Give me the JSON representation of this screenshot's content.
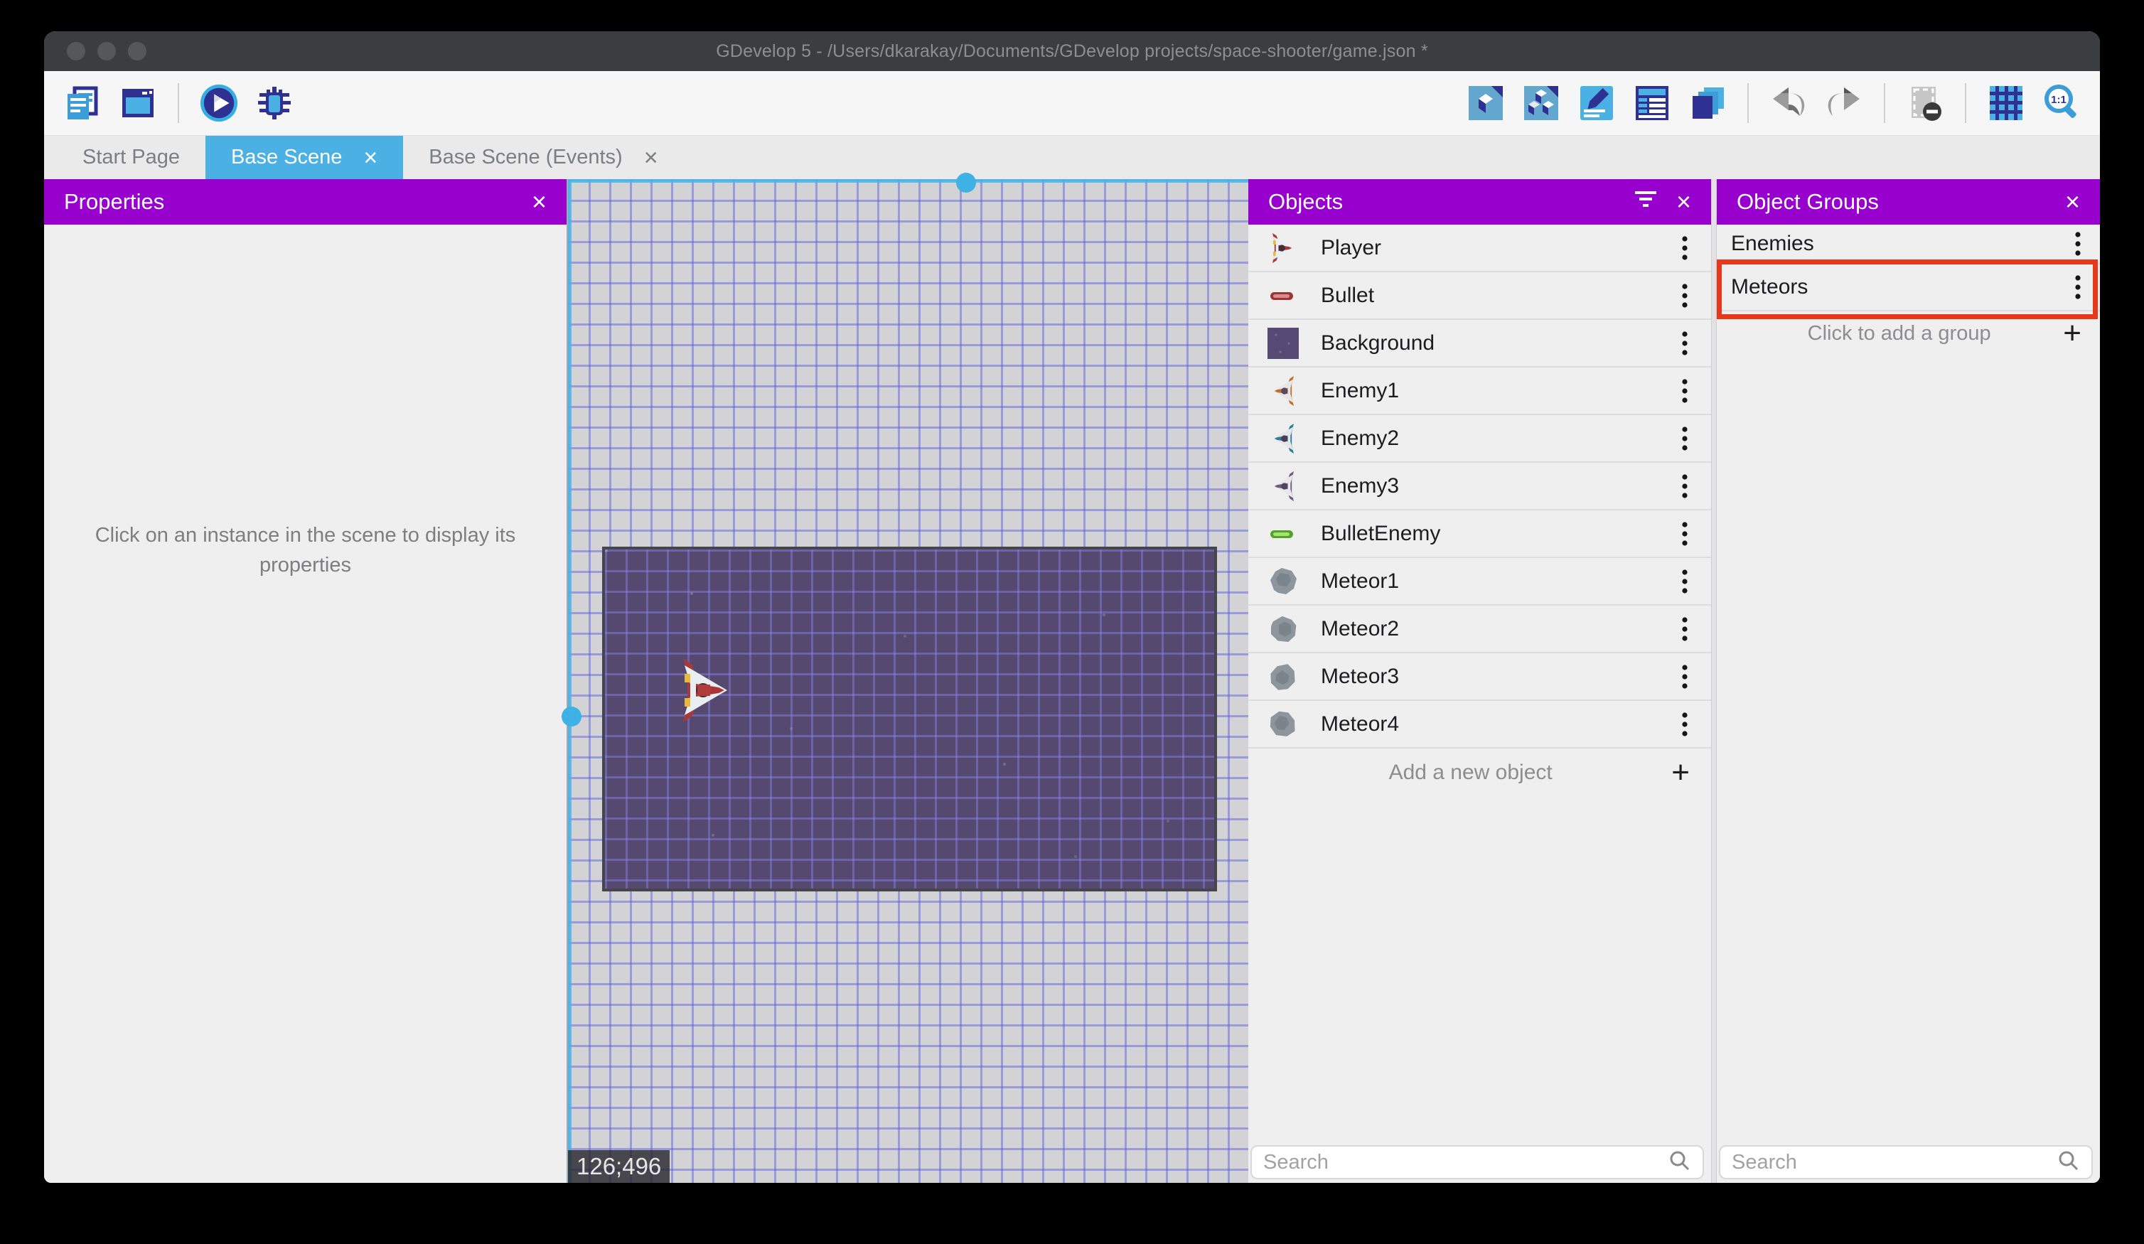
{
  "window": {
    "title": "GDevelop 5 - /Users/dkarakay/Documents/GDevelop projects/space-shooter/game.json *"
  },
  "glyphs": {
    "close": "×",
    "plus": "+"
  },
  "colors": {
    "panel_header_purple": "#9800cd",
    "active_tab_blue": "#4bb0e3",
    "annotation_red": "#e8381c",
    "selection_cyan": "#3eb2e5",
    "titlebar": "#3a3e41"
  },
  "toolbar": {
    "left_icons": [
      "project-manager",
      "start-page-window",
      "preview-play",
      "debug"
    ],
    "right_icons": [
      "edit-object",
      "edit-objects-group",
      "edit-scene-properties",
      "open-instances-list",
      "open-layers",
      "undo",
      "redo",
      "toggle-instances-masks",
      "toggle-grid",
      "zoom-1-1"
    ]
  },
  "tabs": [
    {
      "label": "Start Page",
      "active": false,
      "closable": false
    },
    {
      "label": "Base Scene",
      "active": true,
      "closable": true
    },
    {
      "label": "Base Scene (Events)",
      "active": false,
      "closable": true
    }
  ],
  "properties_panel": {
    "title": "Properties",
    "empty_message": "Click on an instance in the scene to display its properties"
  },
  "scene": {
    "coordinates": "126;496",
    "selected_instance": "Background"
  },
  "objects_panel": {
    "title": "Objects",
    "items": [
      {
        "name": "Player",
        "icon": "player-ship"
      },
      {
        "name": "Bullet",
        "icon": "red-bullet"
      },
      {
        "name": "Background",
        "icon": "purple-background"
      },
      {
        "name": "Enemy1",
        "icon": "enemy-ship-orange"
      },
      {
        "name": "Enemy2",
        "icon": "enemy-ship-teal"
      },
      {
        "name": "Enemy3",
        "icon": "enemy-ship-purple"
      },
      {
        "name": "BulletEnemy",
        "icon": "green-bullet"
      },
      {
        "name": "Meteor1",
        "icon": "meteor-rock"
      },
      {
        "name": "Meteor2",
        "icon": "meteor-rock"
      },
      {
        "name": "Meteor3",
        "icon": "meteor-rock"
      },
      {
        "name": "Meteor4",
        "icon": "meteor-rock"
      }
    ],
    "add_label": "Add a new object",
    "search_placeholder": "Search"
  },
  "object_groups_panel": {
    "title": "Object Groups",
    "items": [
      {
        "name": "Enemies",
        "highlighted": false
      },
      {
        "name": "Meteors",
        "highlighted": true
      }
    ],
    "add_label": "Click to add a group",
    "search_placeholder": "Search"
  }
}
